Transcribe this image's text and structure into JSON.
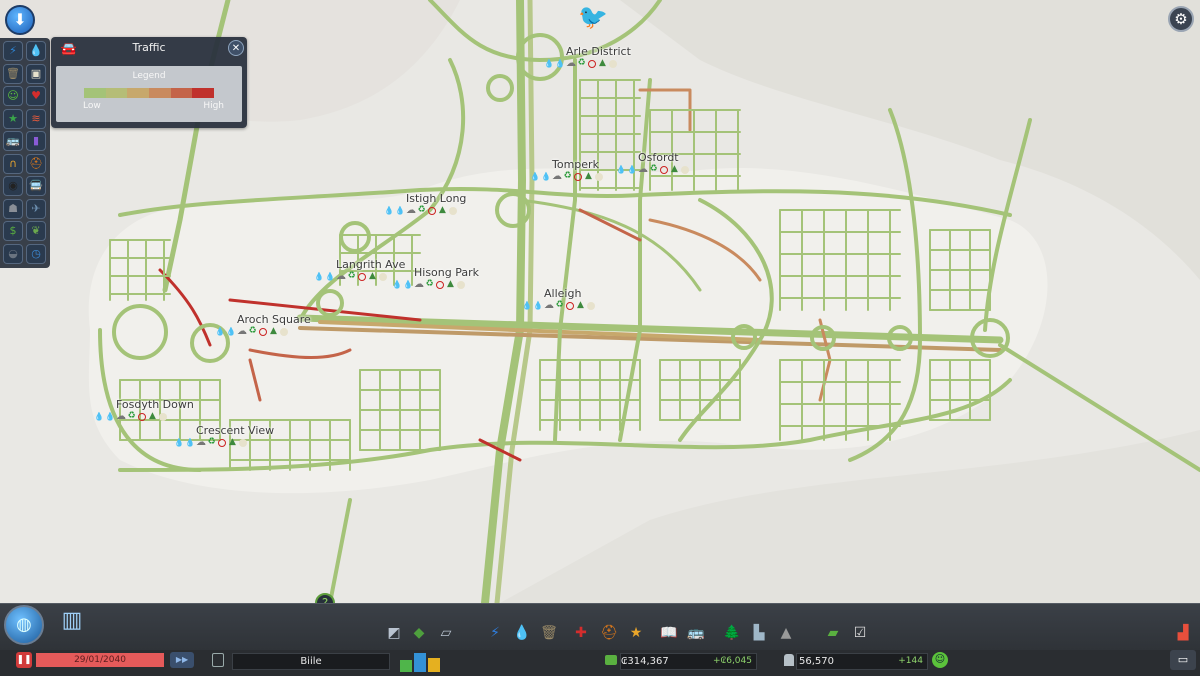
{
  "traffic_panel": {
    "title": "Traffic",
    "car_icon": "car-icon",
    "legend_title": "Legend",
    "low_label": "Low",
    "high_label": "High",
    "gradient": [
      "#a4c378",
      "#b5bd77",
      "#c7a86c",
      "#c98a5e",
      "#c46449",
      "#c0312c"
    ]
  },
  "districts": [
    {
      "name": "Arle District"
    },
    {
      "name": "Tomperk"
    },
    {
      "name": "Osfordt"
    },
    {
      "name": "Istigh Long"
    },
    {
      "name": "Langrith Ave"
    },
    {
      "name": "Hisong Park"
    },
    {
      "name": "Alleigh"
    },
    {
      "name": "Aroch Square"
    },
    {
      "name": "Fosdyth Down"
    },
    {
      "name": "Crescent View"
    }
  ],
  "toolbar": {
    "info_views": [
      "electricity-icon",
      "water-icon",
      "garbage-icon",
      "land-value-icon",
      "happiness-icon",
      "health-icon",
      "level-icon",
      "noise-icon",
      "public-transport-icon",
      "education-icon",
      "road-icon",
      "fire-icon",
      "crime-icon",
      "transport-routes-icon",
      "population-icon",
      "wind-icon",
      "money-icon",
      "nature-icon",
      "tunnel-icon",
      "clock-icon"
    ]
  },
  "bottom_bar": {
    "date": "29/01/2040",
    "city_name": "Biile",
    "money": "₢314,367",
    "money_delta": "+₢6,045",
    "population": "56,570",
    "population_delta": "+144",
    "demand": {
      "residential": 0.55,
      "commercial": 0.85,
      "industrial": 0.62
    },
    "colors": {
      "residential": "#4fb54a",
      "commercial": "#3391d6",
      "industrial": "#e5b020"
    }
  },
  "colors": {
    "terrain": "#ecebe7",
    "ui_panel": "#2a323e",
    "road_low": "#a4c378",
    "road_high": "#c0312c"
  }
}
